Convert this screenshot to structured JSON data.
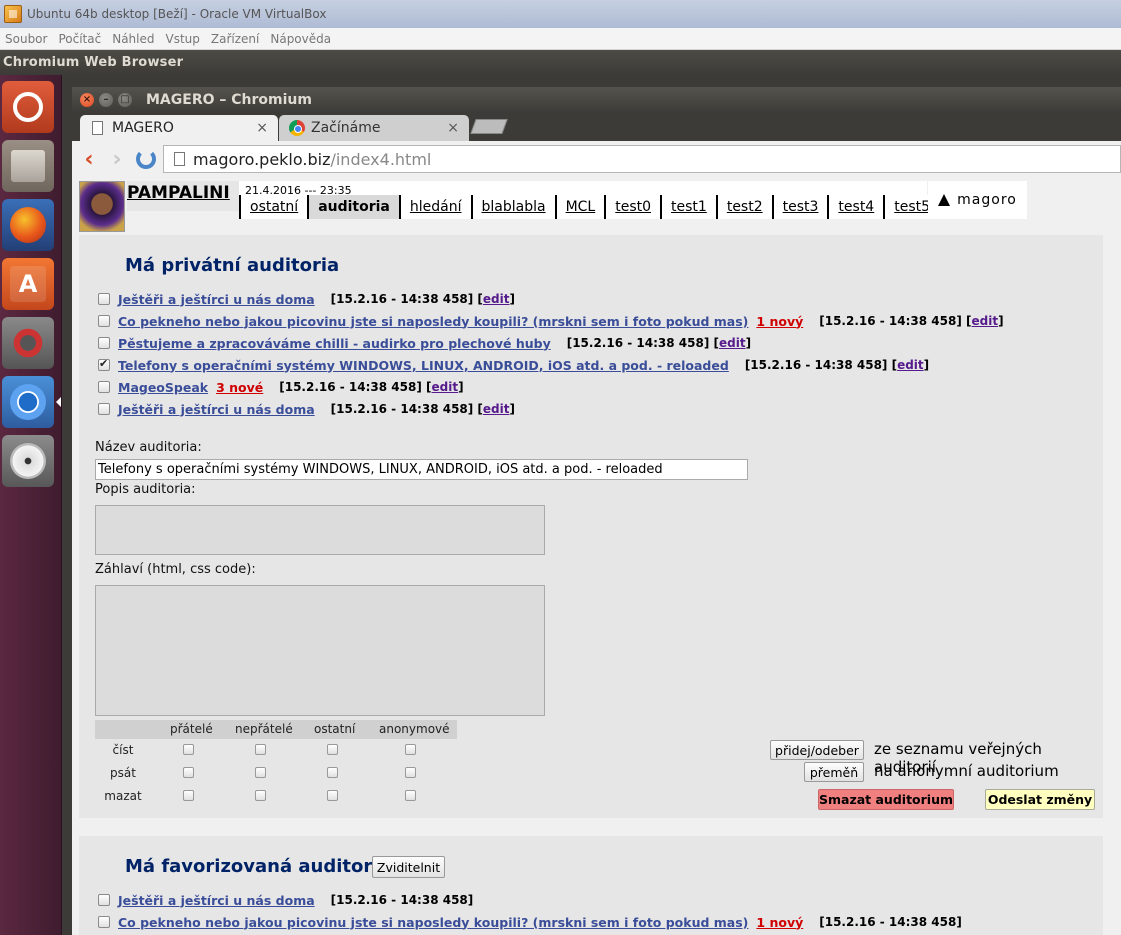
{
  "vbox": {
    "title": "Ubuntu 64b desktop [Beží] - Oracle VM VirtualBox",
    "menu": [
      "Soubor",
      "Počítač",
      "Náhled",
      "Vstup",
      "Zařízení",
      "Nápověda"
    ]
  },
  "ubuntu_panel": {
    "app_name": "Chromium Web Browser"
  },
  "launcher": {
    "items": [
      "ubuntu-dash-icon",
      "files-icon",
      "firefox-icon",
      "software-center-icon",
      "system-settings-icon",
      "chromium-icon",
      "disc-icon"
    ],
    "store_glyph": "A"
  },
  "browser": {
    "window_title": "MAGERO – Chromium",
    "window_buttons": {
      "close": "×",
      "minimize": "–",
      "maximize": "□"
    },
    "tabs": [
      {
        "label": "MAGERO",
        "close": "×"
      },
      {
        "label": "Začínáme",
        "close": "×"
      }
    ],
    "url_host": "magoro.peklo.biz",
    "url_path": "/index4.html",
    "nav_glyphs": {
      "back": "‹",
      "forward": "›"
    }
  },
  "header": {
    "username": "PAMPALINI",
    "datetime": "21.4.2016 --- 23:35",
    "nav": [
      "ostatní",
      "auditoria",
      "hledání",
      "blablabla",
      "MCL",
      "test0",
      "test1",
      "test2",
      "test3",
      "test4",
      "test5"
    ],
    "active_nav": 1,
    "logo_text": "magoro"
  },
  "private": {
    "title": "Má privátní auditoria",
    "items": [
      {
        "name": "Ještěři a ještírci u nás doma",
        "new": "",
        "meta": "[15.2.16 - 14:38 458] [",
        "edit": "edit",
        "close": "]",
        "checked": false
      },
      {
        "name": "Co pekneho nebo jakou picovinu jste si naposledy koupili? (mrskni sem i foto pokud mas)",
        "new": "1 nový",
        "meta": "[15.2.16 - 14:38 458] [",
        "edit": "edit",
        "close": "]",
        "checked": false
      },
      {
        "name": "Pěstujeme a zpracováváme chilli - audirko pro plechové huby",
        "new": "",
        "meta": "[15.2.16 - 14:38 458] [",
        "edit": "edit",
        "close": "]",
        "checked": false
      },
      {
        "name": "Telefony s operačními systémy WINDOWS, LINUX, ANDROID, iOS atd. a pod. - reloaded",
        "new": "",
        "meta": "[15.2.16 - 14:38 458] [",
        "edit": "edit",
        "close": "]",
        "checked": true
      },
      {
        "name": "MageoSpeak",
        "new": "3 nové",
        "meta": "[15.2.16 - 14:38 458] [",
        "edit": "edit",
        "close": "]",
        "checked": false
      },
      {
        "name": "Ještěři a ještírci u nás doma",
        "new": "",
        "meta": "[15.2.16 - 14:38 458] [",
        "edit": "edit",
        "close": "]",
        "checked": false
      }
    ],
    "form": {
      "name_label": "Název auditoria:",
      "name_value": "Telefony s operačními systémy WINDOWS, LINUX, ANDROID, iOS atd. a pod. - reloaded",
      "desc_label": "Popis auditoria:",
      "header_label": "Záhlaví (html, css code):"
    },
    "permissions": {
      "columns": [
        "přátelé",
        "nepřátelé",
        "ostatní",
        "anonymové"
      ],
      "rows": [
        "číst",
        "psát",
        "mazat"
      ]
    },
    "buttons": {
      "add_remove": "přidej/odeber",
      "add_remove_desc": "ze seznamu veřejných auditorií",
      "change": "přeměň",
      "change_desc": "na anonymní auditorium",
      "delete": "Smazat auditorium",
      "submit": "Odeslat změny"
    }
  },
  "favorite": {
    "title": "Má favorizovaná auditoria",
    "show_button": "Zviditelnit",
    "items": [
      {
        "name": "Ještěři a ještírci u nás doma",
        "new": "",
        "meta": "[15.2.16 - 14:38 458]",
        "checked": false
      },
      {
        "name": "Co pekneho nebo jakou picovinu jste si naposledy koupili? (mrskni sem i foto pokud mas)",
        "new": "1 nový",
        "meta": "[15.2.16 - 14:38 458]",
        "checked": false
      }
    ]
  }
}
